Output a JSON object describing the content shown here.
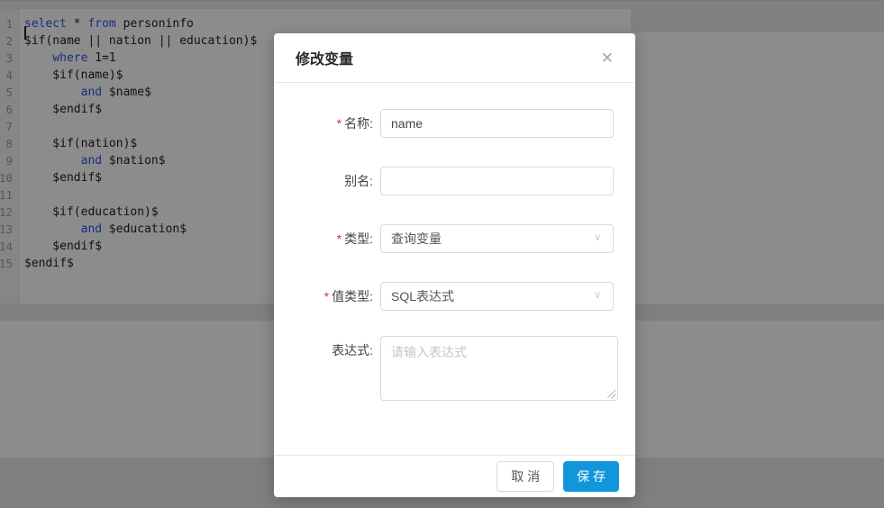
{
  "editor": {
    "lines": [
      {
        "num": "1",
        "parts": [
          [
            "kw",
            "select"
          ],
          [
            "tx",
            " * "
          ],
          [
            "kw",
            "from"
          ],
          [
            "tx",
            " personinfo"
          ]
        ]
      },
      {
        "num": "2",
        "parts": [
          [
            "tx",
            "$if(name || nation || education)$"
          ]
        ]
      },
      {
        "num": "3",
        "parts": [
          [
            "tx",
            "    "
          ],
          [
            "kw",
            "where"
          ],
          [
            "tx",
            " 1=1"
          ]
        ]
      },
      {
        "num": "4",
        "parts": [
          [
            "tx",
            "    $if(name)$"
          ]
        ]
      },
      {
        "num": "5",
        "parts": [
          [
            "tx",
            "        "
          ],
          [
            "kw",
            "and"
          ],
          [
            "tx",
            " $name$"
          ]
        ]
      },
      {
        "num": "6",
        "parts": [
          [
            "tx",
            "    $endif$"
          ]
        ]
      },
      {
        "num": "7",
        "parts": []
      },
      {
        "num": "8",
        "parts": [
          [
            "tx",
            "    $if(nation)$"
          ]
        ]
      },
      {
        "num": "9",
        "parts": [
          [
            "tx",
            "        "
          ],
          [
            "kw",
            "and"
          ],
          [
            "tx",
            " $nation$"
          ]
        ]
      },
      {
        "num": "10",
        "parts": [
          [
            "tx",
            "    $endif$"
          ]
        ]
      },
      {
        "num": "11",
        "parts": []
      },
      {
        "num": "12",
        "parts": [
          [
            "tx",
            "    $if(education)$"
          ]
        ]
      },
      {
        "num": "13",
        "parts": [
          [
            "tx",
            "        "
          ],
          [
            "kw",
            "and"
          ],
          [
            "tx",
            " $education$"
          ]
        ]
      },
      {
        "num": "14",
        "parts": [
          [
            "tx",
            "    $endif$"
          ]
        ]
      },
      {
        "num": "15",
        "parts": [
          [
            "tx",
            "$endif$"
          ]
        ]
      }
    ],
    "keyword_color": "#2f55f0"
  },
  "modal": {
    "title": "修改变量",
    "required_mark": "*",
    "fields": [
      {
        "label": "名称:",
        "required": true,
        "type": "input",
        "value": "name",
        "placeholder": ""
      },
      {
        "label": "别名:",
        "required": false,
        "type": "input",
        "value": "",
        "placeholder": ""
      },
      {
        "label": "类型:",
        "required": true,
        "type": "select",
        "value": "查询变量"
      },
      {
        "label": "值类型:",
        "required": true,
        "type": "select",
        "value": "SQL表达式"
      },
      {
        "label": "表达式:",
        "required": false,
        "type": "textarea",
        "value": "",
        "placeholder": "请输入表达式"
      }
    ],
    "footer": {
      "cancel_label": "取 消",
      "save_label": "保 存"
    },
    "icons": {
      "close": "✕",
      "chevron_down": "∨"
    },
    "colors": {
      "primary": "#1296db",
      "required": "#f5222d"
    }
  }
}
